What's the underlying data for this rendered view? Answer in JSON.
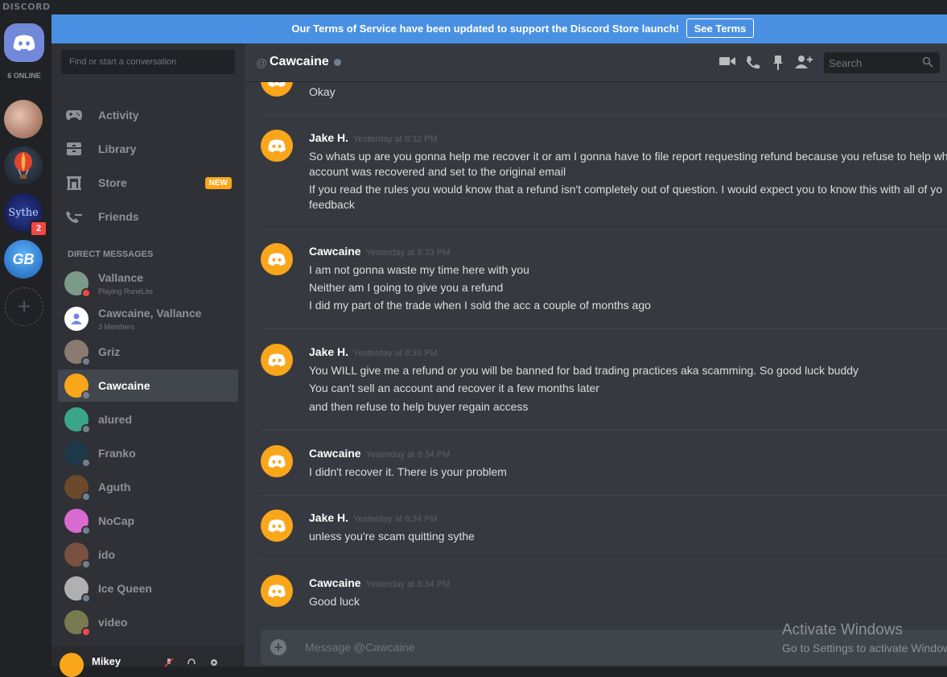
{
  "app": {
    "brand": "DISCORD"
  },
  "guilds": {
    "online_count": "6 ONLINE",
    "items": [
      {
        "name": "profile-guild"
      },
      {
        "name": "balloon-guild"
      },
      {
        "name": "sythe-guild",
        "label": "Sythe",
        "badge": "2"
      },
      {
        "name": "gb-guild",
        "label": "GB"
      }
    ],
    "add_label": "+"
  },
  "banner": {
    "text": "Our Terms of Service have been updated to support the Discord Store launch!",
    "button": "See Terms"
  },
  "sidebar": {
    "search_placeholder": "Find or start a conversation",
    "nav": [
      {
        "label": "Activity",
        "icon": "gamepad-icon"
      },
      {
        "label": "Library",
        "icon": "library-icon"
      },
      {
        "label": "Store",
        "icon": "store-icon",
        "badge": "NEW"
      },
      {
        "label": "Friends",
        "icon": "friends-icon"
      }
    ],
    "dm_header": "DIRECT MESSAGES",
    "dms": [
      {
        "name": "Vallance",
        "sub": "Playing RuneLite",
        "status": "dnd",
        "color": "#7c9a8a"
      },
      {
        "name": "Cawcaine, Vallance",
        "sub": "3 Members",
        "status": "",
        "color": "#ffffff"
      },
      {
        "name": "Griz",
        "sub": "",
        "status": "offline",
        "color": "#8a7a70"
      },
      {
        "name": "Cawcaine",
        "sub": "",
        "status": "offline",
        "color": "#faa61a",
        "active": true
      },
      {
        "name": "alured",
        "sub": "",
        "status": "offline",
        "color": "#3aa58a"
      },
      {
        "name": "Franko",
        "sub": "",
        "status": "offline",
        "color": "#1e3a4a"
      },
      {
        "name": "Aguth",
        "sub": "",
        "status": "offline",
        "color": "#6a4a2a"
      },
      {
        "name": "NoCap",
        "sub": "",
        "status": "offline",
        "color": "#d96ad0"
      },
      {
        "name": "ido",
        "sub": "",
        "status": "offline",
        "color": "#7a5040"
      },
      {
        "name": "Ice Queen",
        "sub": "",
        "status": "offline",
        "color": "#b0b0b0"
      },
      {
        "name": "video",
        "sub": "",
        "status": "dnd",
        "color": "#7a7a50"
      }
    ]
  },
  "user_panel": {
    "name": "Mikey"
  },
  "chat": {
    "header": {
      "at": "@",
      "name": "Cawcaine"
    },
    "search_placeholder": "Search",
    "messages": [
      {
        "author": "",
        "time": "",
        "lines": [
          "Okay"
        ]
      },
      {
        "author": "Jake H.",
        "time": "Yesterday at 8:32 PM",
        "lines": [
          "So whats up are you gonna help me recover it or am I gonna have to file report requesting refund because you refuse to help whe",
          "account was recovered and set to the original email",
          "If you read the rules you would know that a refund isn't completely out of question. I would expect you to know this with all of yo",
          "feedback"
        ]
      },
      {
        "author": "Cawcaine",
        "time": "Yesterday at 8:33 PM",
        "lines": [
          "I am not gonna waste my time here with you",
          "Neither am I going to give you a refund",
          "I did my part of the trade when I sold the acc a couple of months ago"
        ]
      },
      {
        "author": "Jake H.",
        "time": "Yesterday at 8:33 PM",
        "lines": [
          "You WILL give me a refund or you will be banned for bad trading practices aka scamming. So good luck buddy",
          "You can't sell an account and recover it a few months later",
          "and then refuse to help buyer regain access"
        ]
      },
      {
        "author": "Cawcaine",
        "time": "Yesterday at 8:34 PM",
        "lines": [
          "I didn't recover it. There is your problem"
        ]
      },
      {
        "author": "Jake H.",
        "time": "Yesterday at 8:34 PM",
        "lines": [
          "unless you're scam quitting sythe"
        ]
      },
      {
        "author": "Cawcaine",
        "time": "Yesterday at 8:34 PM",
        "lines": [
          "Good luck"
        ]
      }
    ],
    "composer_placeholder": "Message @Cawcaine"
  },
  "watermark": {
    "line1": "Activate Windows",
    "line2": "Go to Settings to activate Windows."
  }
}
